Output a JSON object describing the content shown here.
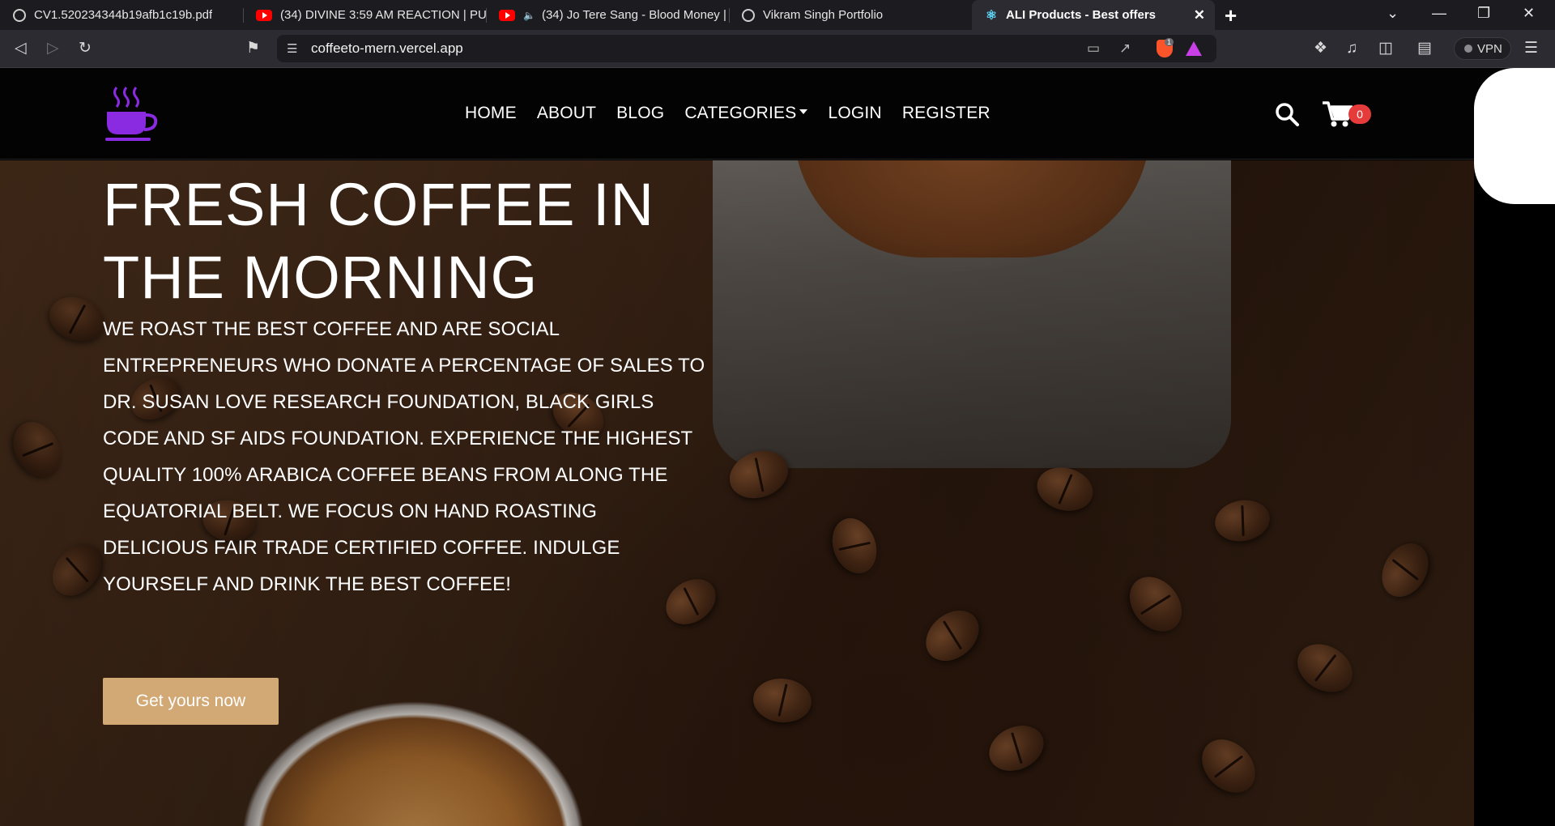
{
  "browser": {
    "tabs": [
      {
        "title": "CV1.520234344b19afb1c19b.pdf",
        "icon": "globe-icon"
      },
      {
        "title": "(34) DIVINE 3:59 AM REACTION | PUN",
        "icon": "youtube-icon"
      },
      {
        "title": "(34) Jo Tere Sang - Blood Money |",
        "icon": "youtube-icon",
        "audio": true
      },
      {
        "title": "Vikram Singh Portfolio",
        "icon": "globe-icon"
      },
      {
        "title": "ALI Products - Best offers",
        "icon": "react-icon",
        "active": true
      }
    ],
    "url": "coffeeto-mern.vercel.app",
    "vpn_label": "VPN",
    "brave_shield_count": "1"
  },
  "navbar": {
    "links": [
      "HOME",
      "ABOUT",
      "BLOG",
      "CATEGORIES",
      "LOGIN",
      "REGISTER"
    ],
    "cart_count": "0"
  },
  "hero": {
    "title_line1": "FRESH COFFEE IN",
    "title_line2": "THE MORNING",
    "text_lines": [
      "WE ROAST THE BEST COFFEE AND ARE SOCIAL",
      "ENTREPRENEURS WHO DONATE A PERCENTAGE OF SALES TO",
      "DR. SUSAN LOVE RESEARCH FOUNDATION, BLACK GIRLS",
      "CODE AND SF AIDS FOUNDATION. EXPERIENCE THE HIGHEST",
      "QUALITY 100% ARABICA COFFEE BEANS FROM ALONG THE",
      "EQUATORIAL BELT. WE FOCUS ON HAND ROASTING",
      "DELICIOUS FAIR TRADE CERTIFIED COFFEE. INDULGE",
      "YOURSELF AND DRINK THE BEST COFFEE!"
    ],
    "cta_label": "Get yours now"
  },
  "colors": {
    "logo_purple": "#8a2be2",
    "cta_bg": "#d2a874",
    "cart_badge": "#e53b3b",
    "nav_bg": "#030303"
  }
}
